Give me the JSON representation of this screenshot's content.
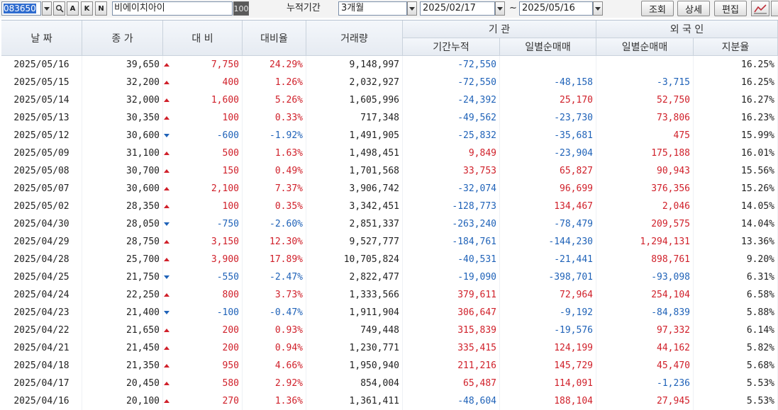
{
  "toolbar": {
    "code": "083650",
    "btn_k": "K",
    "btn_n": "N",
    "btn_a": "A",
    "name": "비에이치아이",
    "qty": "100",
    "period_label": "누적기간",
    "period": "3개월",
    "start_date": "2025/02/17",
    "tilde": "~",
    "end_date": "2025/05/16",
    "btn_query": "조회",
    "btn_detail": "상세",
    "btn_edit": "편집",
    "icons": [
      "search-icon",
      "line-chart-icon"
    ]
  },
  "headers": {
    "date": "날 짜",
    "close": "종 가",
    "change": "대 비",
    "rate": "대비율",
    "volume": "거래량",
    "institution": "기 관",
    "inst_cum": "기간누적",
    "inst_net": "일별순매매",
    "foreign": "외 국 인",
    "for_net": "일별순매매",
    "for_own": "지분율"
  },
  "colors": {
    "up": "#d0202a",
    "down": "#1f62b8"
  },
  "rows": [
    {
      "date": "2025/05/16",
      "close": "39,650",
      "dir": "up",
      "change": "7,750",
      "rate": "24.29%",
      "volume": "9,148,997",
      "inst_cum": "-72,550",
      "inst_net": "",
      "for_net": "",
      "for_own": "16.25%"
    },
    {
      "date": "2025/05/15",
      "close": "32,200",
      "dir": "up",
      "change": "400",
      "rate": "1.26%",
      "volume": "2,032,927",
      "inst_cum": "-72,550",
      "inst_net": "-48,158",
      "for_net": "-3,715",
      "for_own": "16.25%"
    },
    {
      "date": "2025/05/14",
      "close": "32,000",
      "dir": "up",
      "change": "1,600",
      "rate": "5.26%",
      "volume": "1,605,996",
      "inst_cum": "-24,392",
      "inst_net": "25,170",
      "for_net": "52,750",
      "for_own": "16.27%"
    },
    {
      "date": "2025/05/13",
      "close": "30,350",
      "dir": "up",
      "change": "100",
      "rate": "0.33%",
      "volume": "717,348",
      "inst_cum": "-49,562",
      "inst_net": "-23,730",
      "for_net": "73,806",
      "for_own": "16.23%"
    },
    {
      "date": "2025/05/12",
      "close": "30,600",
      "dir": "down",
      "change": "-600",
      "rate": "-1.92%",
      "volume": "1,491,905",
      "inst_cum": "-25,832",
      "inst_net": "-35,681",
      "for_net": "475",
      "for_own": "15.99%"
    },
    {
      "date": "2025/05/09",
      "close": "31,100",
      "dir": "up",
      "change": "500",
      "rate": "1.63%",
      "volume": "1,498,451",
      "inst_cum": "9,849",
      "inst_net": "-23,904",
      "for_net": "175,188",
      "for_own": "16.01%"
    },
    {
      "date": "2025/05/08",
      "close": "30,700",
      "dir": "up",
      "change": "150",
      "rate": "0.49%",
      "volume": "1,701,568",
      "inst_cum": "33,753",
      "inst_net": "65,827",
      "for_net": "90,943",
      "for_own": "15.56%"
    },
    {
      "date": "2025/05/07",
      "close": "30,600",
      "dir": "up",
      "change": "2,100",
      "rate": "7.37%",
      "volume": "3,906,742",
      "inst_cum": "-32,074",
      "inst_net": "96,699",
      "for_net": "376,356",
      "for_own": "15.26%"
    },
    {
      "date": "2025/05/02",
      "close": "28,350",
      "dir": "up",
      "change": "100",
      "rate": "0.35%",
      "volume": "3,342,451",
      "inst_cum": "-128,773",
      "inst_net": "134,467",
      "for_net": "2,046",
      "for_own": "14.05%"
    },
    {
      "date": "2025/04/30",
      "close": "28,050",
      "dir": "down",
      "change": "-750",
      "rate": "-2.60%",
      "volume": "2,851,337",
      "inst_cum": "-263,240",
      "inst_net": "-78,479",
      "for_net": "209,575",
      "for_own": "14.04%"
    },
    {
      "date": "2025/04/29",
      "close": "28,750",
      "dir": "up",
      "change": "3,150",
      "rate": "12.30%",
      "volume": "9,527,777",
      "inst_cum": "-184,761",
      "inst_net": "-144,230",
      "for_net": "1,294,131",
      "for_own": "13.36%"
    },
    {
      "date": "2025/04/28",
      "close": "25,700",
      "dir": "up",
      "change": "3,900",
      "rate": "17.89%",
      "volume": "10,705,824",
      "inst_cum": "-40,531",
      "inst_net": "-21,441",
      "for_net": "898,761",
      "for_own": "9.20%"
    },
    {
      "date": "2025/04/25",
      "close": "21,750",
      "dir": "down",
      "change": "-550",
      "rate": "-2.47%",
      "volume": "2,822,477",
      "inst_cum": "-19,090",
      "inst_net": "-398,701",
      "for_net": "-93,098",
      "for_own": "6.31%"
    },
    {
      "date": "2025/04/24",
      "close": "22,250",
      "dir": "up",
      "change": "800",
      "rate": "3.73%",
      "volume": "1,333,566",
      "inst_cum": "379,611",
      "inst_net": "72,964",
      "for_net": "254,104",
      "for_own": "6.58%"
    },
    {
      "date": "2025/04/23",
      "close": "21,400",
      "dir": "down",
      "change": "-100",
      "rate": "-0.47%",
      "volume": "1,911,904",
      "inst_cum": "306,647",
      "inst_net": "-9,192",
      "for_net": "-84,839",
      "for_own": "5.88%"
    },
    {
      "date": "2025/04/22",
      "close": "21,650",
      "dir": "up",
      "change": "200",
      "rate": "0.93%",
      "volume": "749,448",
      "inst_cum": "315,839",
      "inst_net": "-19,576",
      "for_net": "97,332",
      "for_own": "6.14%"
    },
    {
      "date": "2025/04/21",
      "close": "21,450",
      "dir": "up",
      "change": "200",
      "rate": "0.94%",
      "volume": "1,230,771",
      "inst_cum": "335,415",
      "inst_net": "124,199",
      "for_net": "44,162",
      "for_own": "5.82%"
    },
    {
      "date": "2025/04/18",
      "close": "21,350",
      "dir": "up",
      "change": "950",
      "rate": "4.66%",
      "volume": "1,950,940",
      "inst_cum": "211,216",
      "inst_net": "145,729",
      "for_net": "45,470",
      "for_own": "5.68%"
    },
    {
      "date": "2025/04/17",
      "close": "20,450",
      "dir": "up",
      "change": "580",
      "rate": "2.92%",
      "volume": "854,004",
      "inst_cum": "65,487",
      "inst_net": "114,091",
      "for_net": "-1,236",
      "for_own": "5.53%"
    },
    {
      "date": "2025/04/16",
      "close": "20,100",
      "dir": "up",
      "change": "270",
      "rate": "1.36%",
      "volume": "1,361,411",
      "inst_cum": "-48,604",
      "inst_net": "188,104",
      "for_net": "27,945",
      "for_own": "5.53%"
    }
  ]
}
